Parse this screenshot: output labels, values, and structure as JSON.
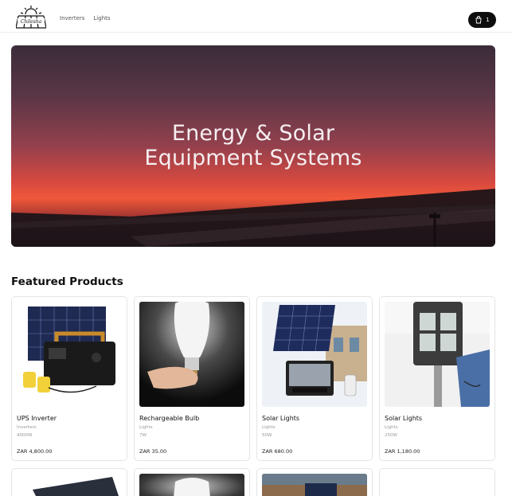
{
  "header": {
    "logo_text": "Chilesha",
    "nav": [
      {
        "label": "Inverters"
      },
      {
        "label": "Lights"
      }
    ],
    "cart_count": "1"
  },
  "hero": {
    "title_line1": "Energy & Solar",
    "title_line2": "Equipment Systems"
  },
  "featured": {
    "title": "Featured Products",
    "products": [
      {
        "name": "UPS Inverter",
        "category": "Inverters",
        "spec": "4000W",
        "price": "ZAR 4,800.00"
      },
      {
        "name": "Rechargeable Bulb",
        "category": "Lights",
        "spec": "7W",
        "price": "ZAR 35.00"
      },
      {
        "name": "Solar Lights",
        "category": "Lights",
        "spec": "50W",
        "price": "ZAR 680.00"
      },
      {
        "name": "Solar Lights",
        "category": "Lights",
        "spec": "250W",
        "price": "ZAR 1,180.00"
      }
    ]
  },
  "colors": {
    "accent": "#0d0d0d",
    "card_border": "#e4e4e4"
  }
}
